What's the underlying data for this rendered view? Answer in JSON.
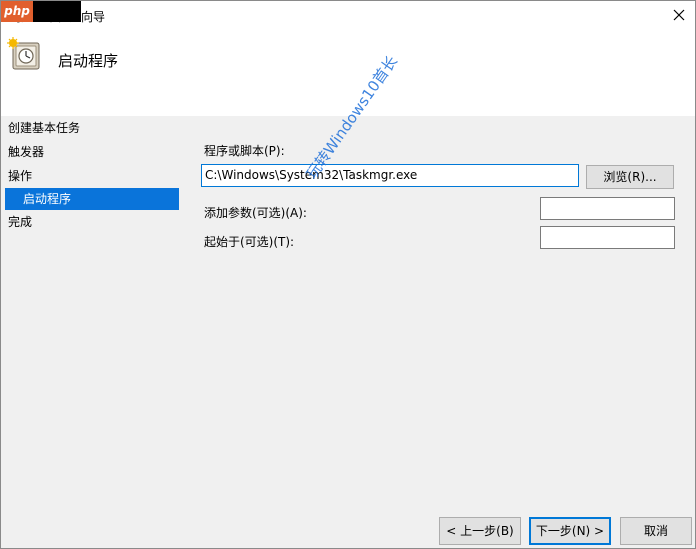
{
  "window": {
    "title": "创建基本任务向导",
    "header_title": "启动程序"
  },
  "overlay": {
    "logo_text": "php",
    "watermark": "玩转Windows10首长"
  },
  "nav": {
    "items": [
      {
        "label": "创建基本任务",
        "selected": false
      },
      {
        "label": "触发器",
        "selected": false
      },
      {
        "label": "操作",
        "selected": false
      },
      {
        "label": "启动程序",
        "selected": true
      },
      {
        "label": "完成",
        "selected": false
      }
    ]
  },
  "form": {
    "program_label": "程序或脚本(P):",
    "program_value": "C:\\Windows\\System32\\Taskmgr.exe",
    "browse_label": "浏览(R)...",
    "args_label": "添加参数(可选)(A):",
    "args_value": "",
    "startin_label": "起始于(可选)(T):",
    "startin_value": ""
  },
  "footer": {
    "back_label": "< 上一步(B)",
    "next_label": "下一步(N) >",
    "cancel_label": "取消"
  },
  "colors": {
    "selection": "#0a74da",
    "focus_border": "#0078d7",
    "watermark": "#1e6fd9"
  }
}
